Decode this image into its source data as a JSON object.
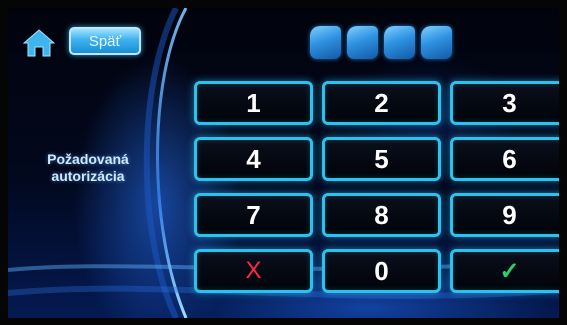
{
  "header": {
    "home_icon": "home-icon",
    "back_label": "Späť"
  },
  "sidebar": {
    "message": "Požadovaná autorizácia"
  },
  "pin_indicator": {
    "digits_total": 4,
    "digits_entered": 0
  },
  "keypad": {
    "keys": [
      "1",
      "2",
      "3",
      "4",
      "5",
      "6",
      "7",
      "8",
      "9",
      "X",
      "0",
      "✓"
    ],
    "cancel_icon": "cancel-x-icon",
    "confirm_icon": "checkmark-icon"
  },
  "colors": {
    "key_border": "#2ec1ee",
    "cancel": "#ff2747",
    "confirm": "#2bd06a",
    "button_blue": "#3fb1ee"
  }
}
